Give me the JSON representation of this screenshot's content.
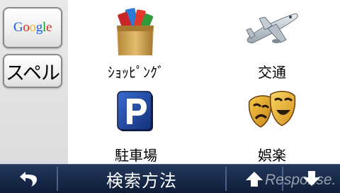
{
  "sidebar": {
    "google_button": {
      "label": "Google",
      "letter_colors": [
        "#1a5fe0",
        "#d62d20",
        "#f3b61f",
        "#1a5fe0",
        "#139c2f",
        "#d62d20"
      ]
    },
    "spell_button": {
      "label": "スペル"
    }
  },
  "categories": [
    {
      "label": "ｼｮｯﾋﾟﾝｸﾞ",
      "icon": "shopping-bag-icon"
    },
    {
      "label": "交通",
      "icon": "airplane-icon"
    },
    {
      "label": "駐車場",
      "icon": "parking-icon"
    },
    {
      "label": "娯楽",
      "icon": "theater-masks-icon"
    }
  ],
  "bottom_bar": {
    "back_icon": "back-arrow-icon",
    "title": "検索方法",
    "up_icon": "up-arrow-icon",
    "down_icon": "down-arrow-icon"
  },
  "watermark": {
    "text": "Response."
  }
}
